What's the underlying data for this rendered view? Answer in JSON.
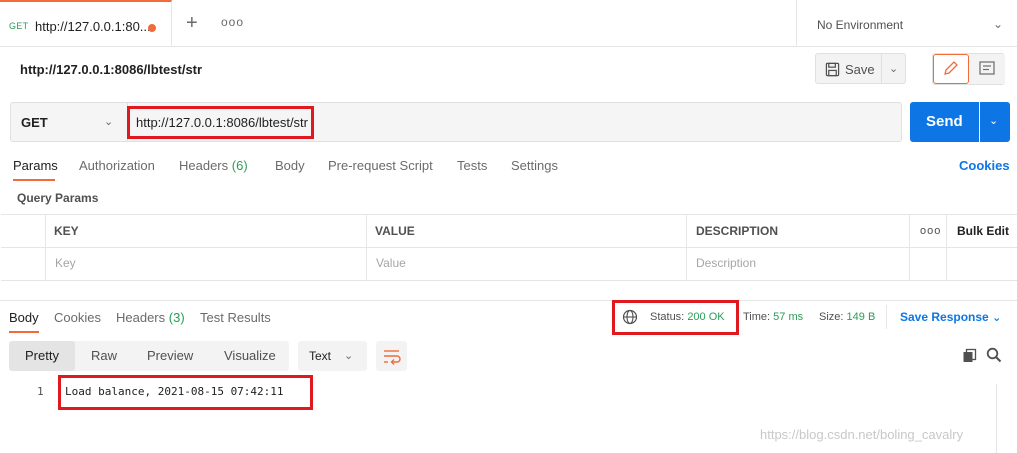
{
  "tab": {
    "method": "GET",
    "url": "http://127.0.0.1:80...",
    "more": "ooo"
  },
  "environment": {
    "label": "No Environment"
  },
  "request": {
    "title": "http://127.0.0.1:8086/lbtest/str",
    "method": "GET",
    "url": "http://127.0.0.1:8086/lbtest/str"
  },
  "toolbar": {
    "save_label": "Save",
    "send_label": "Send"
  },
  "request_tabs": {
    "params": "Params",
    "authorization": "Authorization",
    "headers": "Headers",
    "headers_count": "(6)",
    "body": "Body",
    "prerequest": "Pre-request Script",
    "tests": "Tests",
    "settings": "Settings",
    "cookies": "Cookies"
  },
  "query_params": {
    "title": "Query Params",
    "columns": {
      "key": "KEY",
      "value": "VALUE",
      "description": "DESCRIPTION"
    },
    "more": "ooo",
    "bulk_edit": "Bulk Edit",
    "placeholders": {
      "key": "Key",
      "value": "Value",
      "description": "Description"
    }
  },
  "response": {
    "tabs": {
      "body": "Body",
      "cookies": "Cookies",
      "headers": "Headers",
      "headers_count": "(3)",
      "test_results": "Test Results"
    },
    "status_label": "Status:",
    "status_value": "200 OK",
    "time_label": "Time:",
    "time_value": "57 ms",
    "size_label": "Size:",
    "size_value": "149 B",
    "save_response": "Save Response",
    "views": [
      "Pretty",
      "Raw",
      "Preview",
      "Visualize"
    ],
    "format": "Text",
    "line_number": "1",
    "body_line": "Load balance, 2021-08-15 07:42:11"
  },
  "watermark": "https://blog.csdn.net/boling_cavalry",
  "colors": {
    "accent": "#f26b3a",
    "send": "#0d76e4",
    "success": "#2b9d56",
    "highlight": "#e0191e"
  }
}
